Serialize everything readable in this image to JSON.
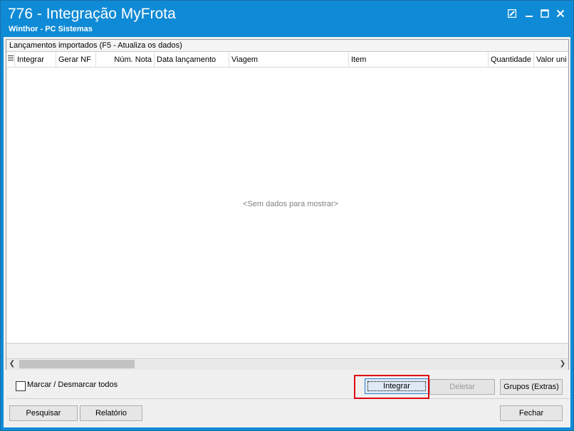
{
  "window": {
    "title": "776 - Integração MyFrota",
    "subtitle": "Winthor - PC Sistemas",
    "controls": [
      "restore-icon",
      "minimize-icon",
      "maximize-icon",
      "close-icon"
    ]
  },
  "panel": {
    "caption": "Lançamentos importados (F5 - Atualiza os dados)",
    "columns": [
      "Integrar",
      "Gerar NF",
      "Núm. Nota",
      "Data lançamento",
      "Viagem",
      "Item",
      "Quantidade",
      "Valor uni"
    ],
    "empty_text": "<Sem dados para mostrar>"
  },
  "bottom": {
    "select_all_label": "Marcar / Desmarcar todos",
    "integrar_label": "Integrar",
    "deletar_label": "Deletar",
    "grupos_label": "Grupos (Extras)",
    "pesquisar_label": "Pesquisar",
    "relatorio_label": "Relatório",
    "fechar_label": "Fechar"
  },
  "colors": {
    "titlebar": "#0f8ad6",
    "highlight": "#e0000f"
  }
}
